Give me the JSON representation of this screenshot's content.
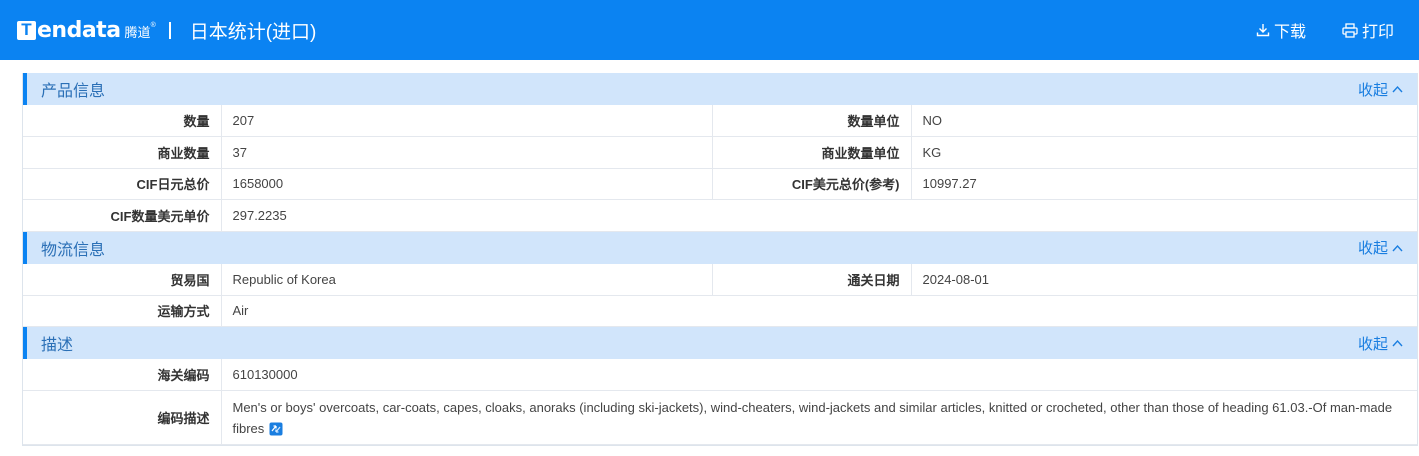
{
  "header": {
    "logo_letter": "T",
    "logo_word": "endata",
    "logo_cn": "腾道",
    "logo_reg": "®",
    "title": "日本统计(进口)",
    "download_label": "下载",
    "print_label": "打印"
  },
  "collapse_label": "收起",
  "sections": {
    "product": {
      "title": "产品信息",
      "rows": [
        {
          "l1": "数量",
          "v1": "207",
          "l2": "数量单位",
          "v2": "NO"
        },
        {
          "l1": "商业数量",
          "v1": "37",
          "l2": "商业数量单位",
          "v2": "KG"
        },
        {
          "l1": "CIF日元总价",
          "v1": "1658000",
          "l2": "CIF美元总价(参考)",
          "v2": "10997.27"
        },
        {
          "l1": "CIF数量美元单价",
          "v1": "297.2235"
        }
      ]
    },
    "logistics": {
      "title": "物流信息",
      "rows": [
        {
          "l1": "贸易国",
          "v1": "Republic of Korea",
          "l2": "通关日期",
          "v2": "2024-08-01"
        },
        {
          "l1": "运输方式",
          "v1": "Air"
        }
      ]
    },
    "description": {
      "title": "描述",
      "hs_label": "海关编码",
      "hs_value": "610130000",
      "desc_label": "编码描述",
      "desc_value": "Men's or boys' overcoats, car-coats, capes, cloaks, anoraks (including ski-jackets), wind-cheaters, wind-jackets and similar articles, knitted or crocheted, other than those of heading 61.03.-Of man-made fibres"
    }
  },
  "colors": {
    "header_bg": "#0b83f2",
    "section_bg": "#d1e5fb",
    "accent": "#1a7ee0"
  }
}
